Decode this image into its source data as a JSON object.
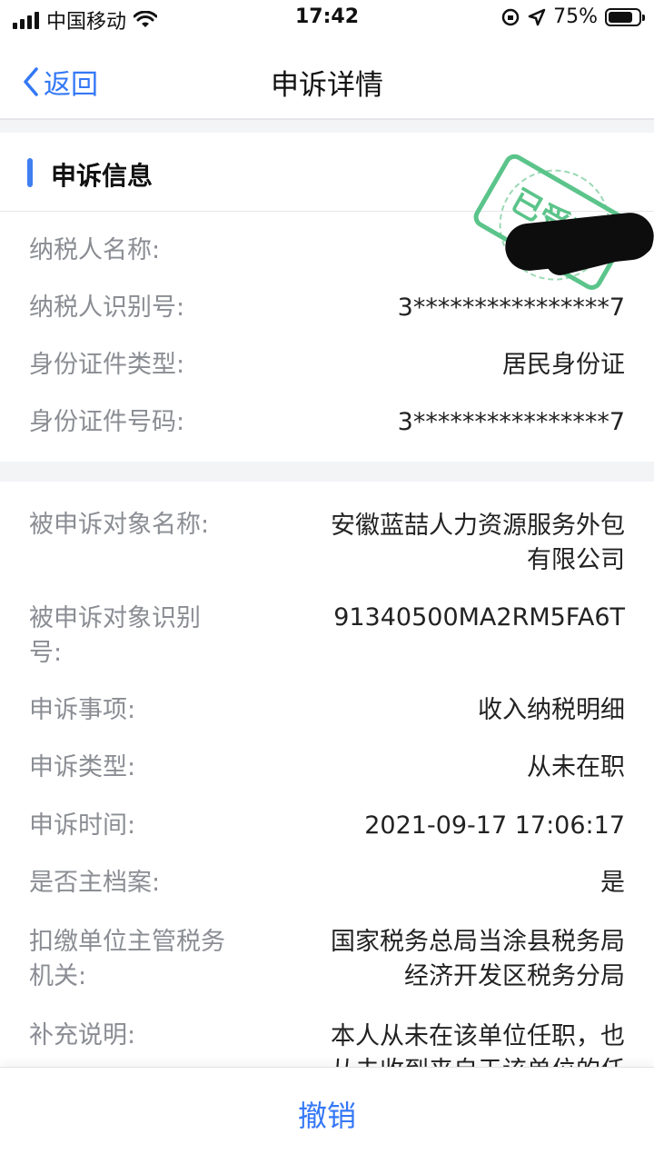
{
  "status_bar": {
    "carrier": "中国移动",
    "time": "17:42",
    "battery_percent": "75%",
    "battery_level": 0.75
  },
  "nav": {
    "back_label": "返回",
    "title": "申诉详情"
  },
  "section": {
    "title": "申诉信息",
    "stamp_text": "已受理"
  },
  "taxpayer": {
    "name_label": "纳税人名称:",
    "name_value": "",
    "id_label": "纳税人识别号:",
    "id_value": "3****************7",
    "cert_type_label": "身份证件类型:",
    "cert_type_value": "居民身份证",
    "cert_no_label": "身份证件号码:",
    "cert_no_value": "3****************7"
  },
  "complaint": {
    "target_name_label": "被申诉对象名称:",
    "target_name_value_line1": "安徽蓝喆人力资源服务外包",
    "target_name_value_line2": "有限公司",
    "target_id_label_line1": "被申诉对象识别",
    "target_id_label_line2": "号:",
    "target_id_value": "91340500MA2RM5FA6T",
    "item_label": "申诉事项:",
    "item_value": "收入纳税明细",
    "type_label": "申诉类型:",
    "type_value": "从未在职",
    "time_label": "申诉时间:",
    "time_value": "2021-09-17 17:06:17",
    "main_file_label": "是否主档案:",
    "main_file_value": "是",
    "authority_label_line1": "扣缴单位主管税务",
    "authority_label_line2": "机关:",
    "authority_value_line1": "国家税务总局当涂县税务局",
    "authority_value_line2": "经济开发区税务分局",
    "note_label": "补充说明:",
    "note_value_line1": "本人从未在该单位任职，也",
    "note_value_line2": "从未收到来自于该单位的任"
  },
  "footer": {
    "revoke_label": "撤销"
  },
  "colors": {
    "accent": "#3478f6",
    "section_bar": "#3f7ff2",
    "stamp": "#5bc48a"
  }
}
